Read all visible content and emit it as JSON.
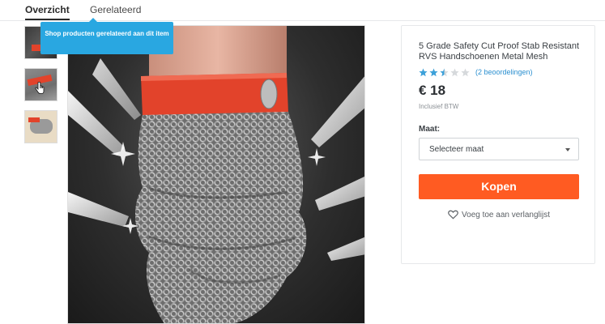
{
  "tabs": [
    {
      "label": "Overzicht"
    },
    {
      "label": "Gerelateerd"
    }
  ],
  "tooltip": {
    "text": "Shop producten gerelateerd aan dit item"
  },
  "thumbnails": [
    {
      "alt": "glove-thumbnail-1"
    },
    {
      "alt": "glove-thumbnail-2"
    },
    {
      "alt": "glove-thumbnail-3"
    }
  ],
  "product": {
    "title": "5 Grade Safety Cut Proof Stab Resistant RVS Handschoenen Metal Mesh",
    "rating": 2.5,
    "rating_max": 5,
    "rating_count_text": "(2 beoordelingen)",
    "price": "€ 18",
    "vat_note": "Inclusief BTW",
    "size_label": "Maat:",
    "size_select": "Selecteer maat",
    "buy_label": "Kopen",
    "wishlist_label": "Voeg toe aan verlanglijst"
  },
  "colors": {
    "accent_blue": "#29a7e1",
    "buy_orange": "#ff5b22",
    "star_blue": "#3da1d9",
    "star_empty": "#d6d9dc",
    "wrist_band_red": "#e2432b"
  }
}
